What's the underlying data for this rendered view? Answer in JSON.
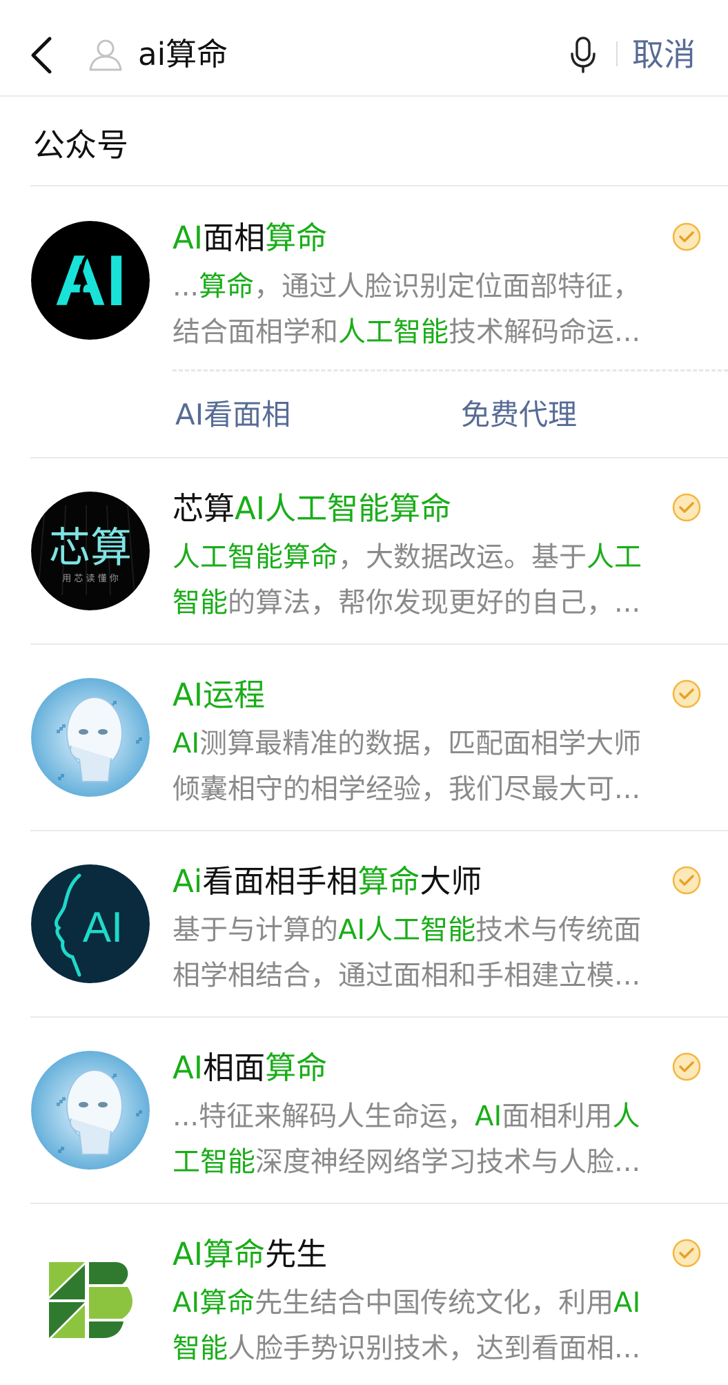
{
  "header": {
    "search_value": "ai算命",
    "cancel_label": "取消"
  },
  "section": {
    "title": "公众号"
  },
  "results": [
    {
      "title": [
        {
          "t": "AI",
          "h": true
        },
        {
          "t": "面相",
          "h": false
        },
        {
          "t": "算命",
          "h": true
        }
      ],
      "desc1": [
        {
          "t": "...",
          "h": false
        },
        {
          "t": "算命",
          "h": true
        },
        {
          "t": "，通过人脸识别定位面部特征，",
          "h": false
        }
      ],
      "desc2": [
        {
          "t": "结合面相学和",
          "h": false
        },
        {
          "t": "人工智能",
          "h": true
        },
        {
          "t": "技术解码命运...",
          "h": false
        }
      ],
      "avatar": "ai-logo-avatar",
      "links": [
        "AI看面相",
        "免费代理"
      ]
    },
    {
      "title": [
        {
          "t": "芯算",
          "h": false
        },
        {
          "t": "AI人工智能算命",
          "h": true
        }
      ],
      "desc1": [
        {
          "t": "人工智能算命",
          "h": true
        },
        {
          "t": "，大数据改运。基于",
          "h": false
        },
        {
          "t": "人工",
          "h": true
        }
      ],
      "desc2": [
        {
          "t": "智能",
          "h": true
        },
        {
          "t": "的算法，帮你发现更好的自己，...",
          "h": false
        }
      ],
      "avatar": "xinsuan-avatar",
      "avatar_text": "芯算",
      "avatar_subtext": "用 芯 读 懂 你"
    },
    {
      "title": [
        {
          "t": "AI运程",
          "h": true
        }
      ],
      "desc1": [
        {
          "t": "AI",
          "h": true
        },
        {
          "t": "测算最精准的数据，匹配面相学大师",
          "h": false
        }
      ],
      "desc2": [
        {
          "t": "倾囊相守的相学经验，我们尽最大可...",
          "h": false
        }
      ],
      "avatar": "robot-face-avatar"
    },
    {
      "title": [
        {
          "t": "Ai",
          "h": true
        },
        {
          "t": "看面相手相",
          "h": false
        },
        {
          "t": "算命",
          "h": true
        },
        {
          "t": "大师",
          "h": false
        }
      ],
      "desc1": [
        {
          "t": "基于与计算的",
          "h": false
        },
        {
          "t": "AI人工智能",
          "h": true
        },
        {
          "t": "技术与传统面",
          "h": false
        }
      ],
      "desc2": [
        {
          "t": "相学相结合，通过面相和手相建立模...",
          "h": false
        }
      ],
      "avatar": "ai-profile-avatar"
    },
    {
      "title": [
        {
          "t": "AI",
          "h": true
        },
        {
          "t": "相面",
          "h": false
        },
        {
          "t": "算命",
          "h": true
        }
      ],
      "desc1": [
        {
          "t": "...特征来解码人生命运，",
          "h": false
        },
        {
          "t": "AI",
          "h": true
        },
        {
          "t": "面相利用",
          "h": false
        },
        {
          "t": "人",
          "h": true
        }
      ],
      "desc2": [
        {
          "t": "工智能",
          "h": true
        },
        {
          "t": "深度神经网络学习技术与人脸...",
          "h": false
        }
      ],
      "avatar": "robot-face-avatar"
    },
    {
      "title": [
        {
          "t": "AI算命",
          "h": true
        },
        {
          "t": "先生",
          "h": false
        }
      ],
      "desc1": [
        {
          "t": "AI算命",
          "h": true
        },
        {
          "t": "先生结合中国传统文化，利用",
          "h": false
        },
        {
          "t": "AI",
          "h": true
        }
      ],
      "desc2": [
        {
          "t": "智能",
          "h": true
        },
        {
          "t": "人脸手势识别技术，达到看面相...",
          "h": false
        }
      ],
      "avatar": "green-b-logo-avatar"
    }
  ],
  "colors": {
    "highlight": "#1aad19",
    "link": "#576b95",
    "verified": "#f4b640"
  }
}
